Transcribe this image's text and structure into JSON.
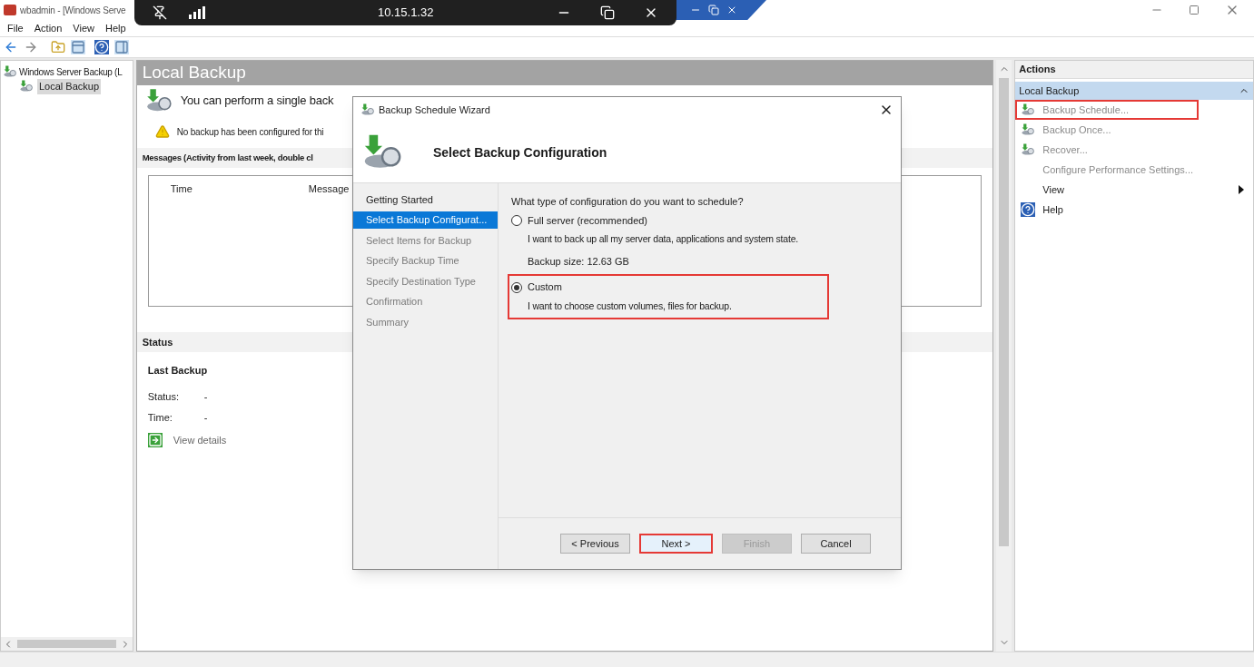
{
  "window": {
    "title": "wbadmin - [Windows Serve"
  },
  "remote_bar": {
    "address": "10.15.1.32"
  },
  "menu": [
    "File",
    "Action",
    "View",
    "Help"
  ],
  "tree": {
    "root": "Windows Server Backup (L",
    "children": [
      {
        "label": "Local Backup",
        "selected": true
      }
    ]
  },
  "center": {
    "title": "Local Backup",
    "intro": "You can perform a single back",
    "warning": "No backup has been configured for thi",
    "messages_heading": "Messages (Activity from last week, double cl",
    "table": {
      "columns": [
        "Time",
        "Message"
      ]
    },
    "status_heading": "Status",
    "last_backup": "Last Backup",
    "fields": [
      {
        "label": "Status:",
        "value": "-"
      },
      {
        "label": "Time:",
        "value": "-"
      }
    ],
    "view_details": "View details"
  },
  "actions": {
    "heading": "Actions",
    "section": "Local Backup",
    "expanded": true,
    "items": [
      {
        "label": "Backup Schedule...",
        "kind": "schedule",
        "disabled": true,
        "highlighted": true
      },
      {
        "label": "Backup Once...",
        "kind": "once",
        "disabled": true,
        "highlighted": false
      },
      {
        "label": "Recover...",
        "kind": "recover",
        "disabled": true,
        "highlighted": false
      },
      {
        "label": "Configure Performance Settings...",
        "kind": "plain",
        "disabled": true,
        "highlighted": false
      },
      {
        "label": "View",
        "kind": "submenu",
        "disabled": false,
        "highlighted": false
      },
      {
        "label": "Help",
        "kind": "help",
        "disabled": false,
        "highlighted": false
      }
    ]
  },
  "dialog": {
    "title": "Backup Schedule Wizard",
    "heading": "Select Backup Configuration",
    "steps": [
      {
        "label": "Getting Started",
        "selected": false,
        "disabled": false
      },
      {
        "label": "Select Backup Configurat...",
        "selected": true,
        "disabled": false
      },
      {
        "label": "Select Items for Backup",
        "selected": false,
        "disabled": true
      },
      {
        "label": "Specify Backup Time",
        "selected": false,
        "disabled": true
      },
      {
        "label": "Specify Destination Type",
        "selected": false,
        "disabled": true
      },
      {
        "label": "Confirmation",
        "selected": false,
        "disabled": true
      },
      {
        "label": "Summary",
        "selected": false,
        "disabled": true
      }
    ],
    "question": "What type of configuration do you want to schedule?",
    "options": [
      {
        "label": "Full server (recommended)",
        "description": "I want to back up all my server data, applications and system state.",
        "note": "Backup size: 12.63 GB",
        "selected": false,
        "highlighted": false
      },
      {
        "label": "Custom",
        "description": "I want to choose custom volumes, files for backup.",
        "selected": true,
        "highlighted": true
      }
    ],
    "buttons": [
      {
        "label": "< Previous",
        "disabled": false,
        "highlighted": false
      },
      {
        "label": "Next >",
        "disabled": false,
        "highlighted": true
      },
      {
        "label": "Finish",
        "disabled": true,
        "highlighted": false
      },
      {
        "label": "Cancel",
        "disabled": false,
        "highlighted": false
      }
    ]
  }
}
